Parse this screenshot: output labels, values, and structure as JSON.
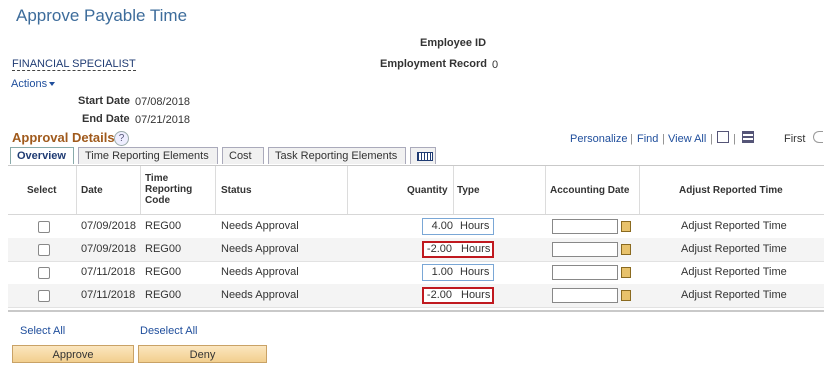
{
  "page": {
    "title": "Approve Payable Time"
  },
  "employee": {
    "id_label": "Employee ID",
    "record_label": "Employment Record",
    "record_value": "0",
    "job_title": "FINANCIAL SPECIALIST",
    "actions_label": "Actions",
    "start_label": "Start Date",
    "start_value": "07/08/2018",
    "end_label": "End Date",
    "end_value": "07/21/2018"
  },
  "section": {
    "title": "Approval Details",
    "help_glyph": "?",
    "personalize": "Personalize",
    "find": "Find",
    "view_all": "View All",
    "sep": "|",
    "first": "First"
  },
  "tabs": [
    "Overview",
    "Time Reporting Elements",
    "Cost",
    "Task Reporting Elements"
  ],
  "columns": {
    "select": "Select",
    "date": "Date",
    "trc": "Time Reporting Code",
    "status": "Status",
    "quantity": "Quantity",
    "type": "Type",
    "accounting_date": "Accounting Date",
    "adjust": "Adjust Reported Time"
  },
  "rows": [
    {
      "date": "07/09/2018",
      "trc": "REG00",
      "status": "Needs Approval",
      "quantity": "4.00",
      "type": "Hours",
      "flag": false,
      "adjust": "Adjust Reported Time"
    },
    {
      "date": "07/09/2018",
      "trc": "REG00",
      "status": "Needs Approval",
      "quantity": "-2.00",
      "type": "Hours",
      "flag": true,
      "adjust": "Adjust Reported Time"
    },
    {
      "date": "07/11/2018",
      "trc": "REG00",
      "status": "Needs Approval",
      "quantity": "1.00",
      "type": "Hours",
      "flag": false,
      "adjust": "Adjust Reported Time"
    },
    {
      "date": "07/11/2018",
      "trc": "REG00",
      "status": "Needs Approval",
      "quantity": "-2.00",
      "type": "Hours",
      "flag": true,
      "adjust": "Adjust Reported Time"
    }
  ],
  "footer": {
    "select_all": "Select All",
    "deselect_all": "Deselect All",
    "approve": "Approve",
    "deny": "Deny"
  },
  "colors": {
    "accent": "#3d6c9b",
    "section_title": "#a05a1c",
    "flag_border": "#c0191f",
    "link": "#1f4e9c"
  }
}
